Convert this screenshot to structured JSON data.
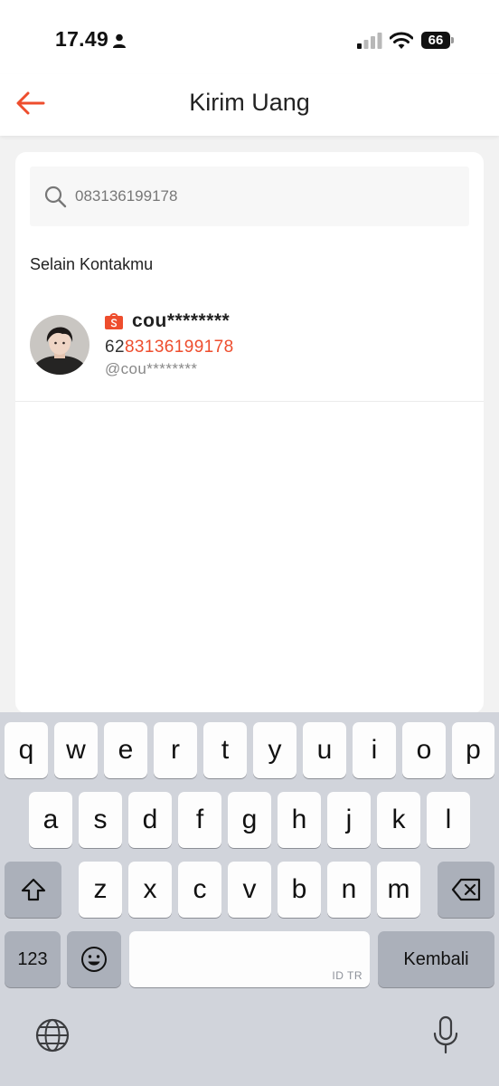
{
  "status_bar": {
    "time": "17.49",
    "battery": "66"
  },
  "header": {
    "title": "Kirim Uang"
  },
  "search": {
    "value": "083136199178"
  },
  "section": {
    "label": "Selain Kontakmu"
  },
  "contact": {
    "name": "cou********",
    "phone_prefix": "62",
    "phone_match": "83136199178",
    "username": "@cou********"
  },
  "keyboard": {
    "row1": [
      "q",
      "w",
      "e",
      "r",
      "t",
      "y",
      "u",
      "i",
      "o",
      "p"
    ],
    "row2": [
      "a",
      "s",
      "d",
      "f",
      "g",
      "h",
      "j",
      "k",
      "l"
    ],
    "row3": [
      "z",
      "x",
      "c",
      "v",
      "b",
      "n",
      "m"
    ],
    "numbers_label": "123",
    "space_hint": "ID TR",
    "return_label": "Kembali"
  },
  "colors": {
    "accent": "#ee4d2d"
  }
}
